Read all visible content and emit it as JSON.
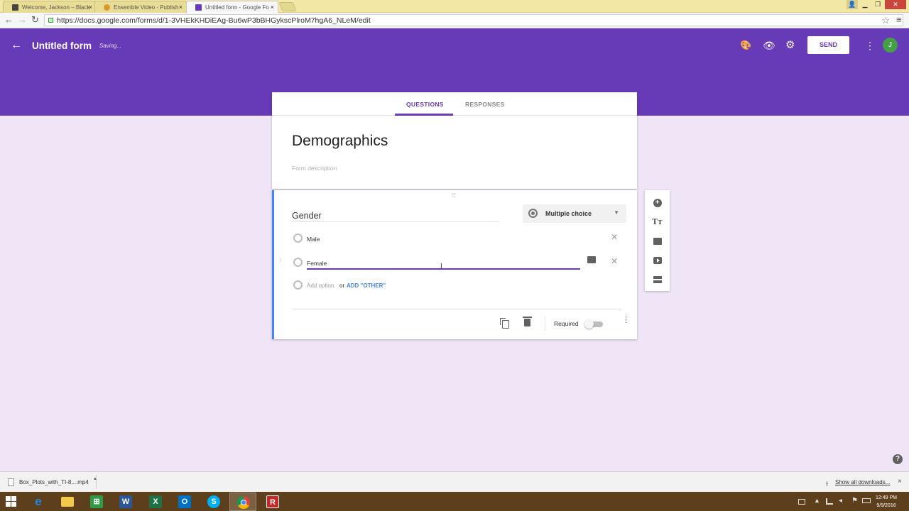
{
  "browser": {
    "tabs": [
      {
        "title": "Welcome, Jackson – Black",
        "favicon_color": "#444444"
      },
      {
        "title": "Ensemble Video - Publish",
        "favicon_color": "#d89b2b"
      },
      {
        "title": "Untitled form - Google Fo",
        "favicon_color": "#673ab7",
        "active": true
      }
    ],
    "close_glyph": "×",
    "url": "https://docs.google.com/forms/d/1-3VHEkKHDiEAg-Bu6wP3bBHGykscPlroM7hgA6_NLeM/edit",
    "back_glyph": "←",
    "forward_glyph": "→",
    "reload_glyph": "↻",
    "star_glyph": "☆",
    "menu_glyph": "≡",
    "window_controls": [
      "▁",
      "❐",
      "✕"
    ]
  },
  "header": {
    "back_glyph": "←",
    "form_title": "Untitled form",
    "save_status": "Saving...",
    "palette_glyph": "🎨",
    "preview_glyph": "👁",
    "settings_glyph": "⚙",
    "send_label": "SEND",
    "more_glyph": "⋮",
    "avatar_initial": "J",
    "accent": "#673ab7"
  },
  "form_tabs": {
    "questions": "QUESTIONS",
    "responses": "RESPONSES"
  },
  "form": {
    "title": "Demographics",
    "description_placeholder": "Form description"
  },
  "question": {
    "drag_glyph": "⠿",
    "title": "Gender",
    "type_label": "Multiple choice",
    "type_caret": "▼",
    "options": [
      {
        "label": "Male"
      },
      {
        "label": "Female"
      }
    ],
    "remove_glyph": "✕",
    "add_option": "Add option",
    "or_text": "or",
    "add_other": "ADD \"OTHER\"",
    "required_label": "Required",
    "required": false,
    "more_glyph": "⋮",
    "cursor_glyph": "I"
  },
  "side_tools": {
    "add_glyph": "+",
    "title_glyph": "Tт"
  },
  "help_glyph": "?",
  "download_bar": {
    "file_name": "Box_Plots_with_TI-8....mp4",
    "caret": "▲",
    "download_glyph": "⭳",
    "show_all": "Show all downloads...",
    "close_glyph": "×"
  },
  "taskbar": {
    "apps": [
      {
        "name": "internet-explorer",
        "glyph": "e",
        "color": "#1e88e5"
      },
      {
        "name": "file-explorer",
        "glyph": "",
        "color": "#f2c94c"
      },
      {
        "name": "store",
        "glyph": "⊞",
        "color": "#2e9b45"
      },
      {
        "name": "word",
        "glyph": "W",
        "color": "#2b5797"
      },
      {
        "name": "excel",
        "glyph": "X",
        "color": "#1e7145"
      },
      {
        "name": "outlook",
        "glyph": "O",
        "color": "#0072c6"
      },
      {
        "name": "skype",
        "glyph": "S",
        "color": "#00aff0"
      },
      {
        "name": "chrome",
        "glyph": "",
        "color": "#db4437",
        "active": true
      },
      {
        "name": "recorder",
        "glyph": "R",
        "color": "#c62828"
      }
    ],
    "time": "12:49 PM",
    "date": "9/9/2016"
  }
}
